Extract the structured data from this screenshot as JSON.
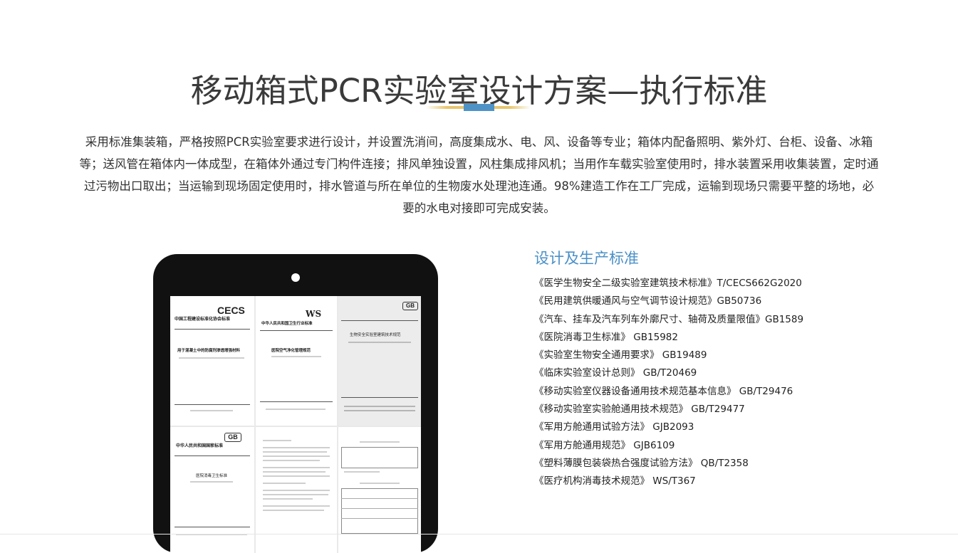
{
  "header": {
    "title": "移动箱式PCR实验室设计方案—执行标准"
  },
  "intro": {
    "text": "采用标准集装箱，严格按照PCR实验室要求进行设计，并设置洗消间，高度集成水、电、风、设备等专业；箱体内配备照明、紫外灯、台柜、设备、冰箱等；送风管在箱体内一体成型，在箱体外通过专门构件连接；排风单独设置，风柱集成排风机；当用作车载实验室使用时，排水装置采用收集装置，定时通过污物出口取出；当运输到现场固定使用时，排水管道与所在单位的生物废水处理池连通。98%建造工作在工厂完成，运输到现场只需要平整的场地，必要的水电对接即可完成安装。"
  },
  "colors": {
    "accent_blue": "#4a90c8",
    "divider_gold": "#e8c66e",
    "divider_center": "#4f93c6",
    "tablet_frame": "#111111"
  },
  "tablet": {
    "docs": {
      "cecs_logo": "CECS",
      "cecs_org": "中国工程建设标准化协会标准",
      "cecs_title": "用于混凝土中的防腐剂渗透增强材料",
      "ws_logo": "WS",
      "ws_org": "中华人民共和国卫生行业标准",
      "ws_title": "医院空气净化管理规范",
      "gb_logo": "GB",
      "gb_title": "生物安全实验室建筑技术规范",
      "gb2_logo": "GB",
      "gb2_org": "中华人民共和国国家标准",
      "gb2_title": "医院消毒卫生标准"
    }
  },
  "standards": {
    "title": "设计及生产标准",
    "items": [
      "《医学生物安全二级实验室建筑技术标准》T/CECS662G2020",
      "《民用建筑供暖通风与空气调节设计规范》GB50736",
      "《汽车、挂车及汽车列车外廓尺寸、轴荷及质量限值》GB1589",
      "《医院消毒卫生标准》 GB15982",
      "《实验室生物安全通用要求》 GB19489",
      "《临床实验室设计总则》 GB/T20469",
      "《移动实验室仪器设备通用技术规范基本信息》 GB/T29476",
      "《移动实验室实验舱通用技术规范》 GB/T29477",
      "《军用方舱通用试验方法》 GJB2093",
      "《军用方舱通用规范》 GJB6109",
      "《塑料薄膜包装袋热合强度试验方法》 QB/T2358",
      "《医疗机构消毒技术规范》 WS/T367"
    ]
  }
}
